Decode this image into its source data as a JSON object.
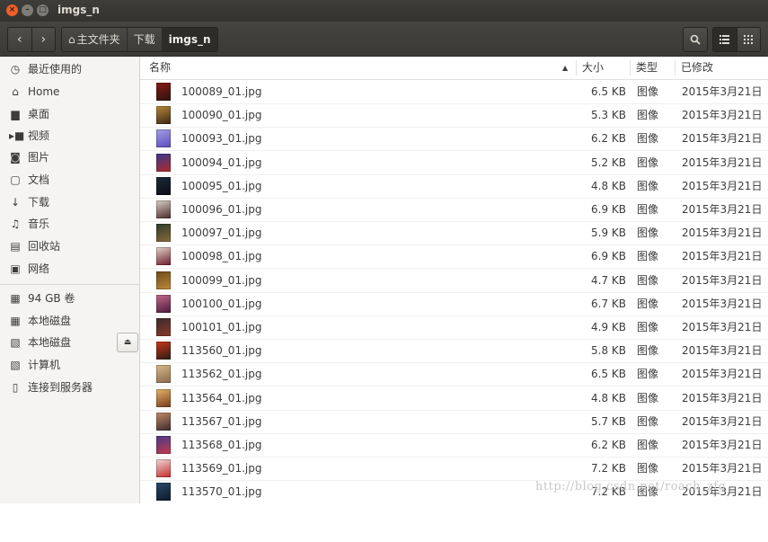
{
  "window": {
    "title": "imgs_n",
    "close_glyph": "×",
    "min_glyph": "–",
    "max_glyph": "□"
  },
  "toolbar": {
    "back_glyph": "‹",
    "forward_glyph": "›",
    "breadcrumbs": [
      "主文件夹",
      "下载",
      "imgs_n"
    ],
    "home_glyph": "⌂",
    "search_glyph": "🔍",
    "list_view_glyph": "☰",
    "grid_view_glyph": "⋮⋮"
  },
  "sidebar": {
    "items": [
      {
        "label": "最近使用的",
        "icon": "clock-icon",
        "glyph": "◷"
      },
      {
        "label": "Home",
        "icon": "home-icon",
        "glyph": "⌂"
      },
      {
        "label": "桌面",
        "icon": "desktop-icon",
        "glyph": "▆"
      },
      {
        "label": "视频",
        "icon": "video-icon",
        "glyph": "▸■"
      },
      {
        "label": "图片",
        "icon": "camera-icon",
        "glyph": "◙"
      },
      {
        "label": "文档",
        "icon": "document-icon",
        "glyph": "▢"
      },
      {
        "label": "下载",
        "icon": "download-icon",
        "glyph": "↓"
      },
      {
        "label": "音乐",
        "icon": "music-icon",
        "glyph": "♫"
      },
      {
        "label": "回收站",
        "icon": "trash-icon",
        "glyph": "▤"
      },
      {
        "label": "网络",
        "icon": "network-icon",
        "glyph": "▣"
      }
    ],
    "devices": [
      {
        "label": "94 GB 卷",
        "icon": "drive-icon",
        "glyph": "▦"
      },
      {
        "label": "本地磁盘",
        "icon": "drive-icon",
        "glyph": "▦"
      },
      {
        "label": "本地磁盘",
        "icon": "drive-icon",
        "glyph": "▧",
        "eject": "⏏"
      },
      {
        "label": "计算机",
        "icon": "computer-icon",
        "glyph": "▧"
      },
      {
        "label": "连接到服务器",
        "icon": "server-icon",
        "glyph": "▯"
      }
    ]
  },
  "columns": {
    "name": "名称",
    "size": "大小",
    "type": "类型",
    "modified": "已修改",
    "sort_glyph": "▲"
  },
  "files": [
    {
      "name": "100089_01.jpg",
      "size": "6.5 KB",
      "type": "图像",
      "modified": "2015年3月21日",
      "thumb_colors": [
        "#8a1a14",
        "#2a1410"
      ]
    },
    {
      "name": "100090_01.jpg",
      "size": "5.3 KB",
      "type": "图像",
      "modified": "2015年3月21日",
      "thumb_colors": [
        "#b98a3a",
        "#3a2614"
      ]
    },
    {
      "name": "100093_01.jpg",
      "size": "6.2 KB",
      "type": "图像",
      "modified": "2015年3月21日",
      "thumb_colors": [
        "#a4a0e4",
        "#5a4cc0"
      ]
    },
    {
      "name": "100094_01.jpg",
      "size": "5.2 KB",
      "type": "图像",
      "modified": "2015年3月21日",
      "thumb_colors": [
        "#3a3a8a",
        "#b02a2a"
      ]
    },
    {
      "name": "100095_01.jpg",
      "size": "4.8 KB",
      "type": "图像",
      "modified": "2015年3月21日",
      "thumb_colors": [
        "#1c2a3a",
        "#0c0c14"
      ]
    },
    {
      "name": "100096_01.jpg",
      "size": "6.9 KB",
      "type": "图像",
      "modified": "2015年3月21日",
      "thumb_colors": [
        "#d8d0c8",
        "#4a2a2a"
      ]
    },
    {
      "name": "100097_01.jpg",
      "size": "5.9 KB",
      "type": "图像",
      "modified": "2015年3月21日",
      "thumb_colors": [
        "#2a3a2a",
        "#8a6a3a"
      ]
    },
    {
      "name": "100098_01.jpg",
      "size": "6.9 KB",
      "type": "图像",
      "modified": "2015年3月21日",
      "thumb_colors": [
        "#e4d4c8",
        "#6a1a2a"
      ]
    },
    {
      "name": "100099_01.jpg",
      "size": "4.7 KB",
      "type": "图像",
      "modified": "2015年3月21日",
      "thumb_colors": [
        "#6a4a1a",
        "#c08a3a"
      ]
    },
    {
      "name": "100100_01.jpg",
      "size": "6.7 KB",
      "type": "图像",
      "modified": "2015年3月21日",
      "thumb_colors": [
        "#c46a8a",
        "#4a1a3a"
      ]
    },
    {
      "name": "100101_01.jpg",
      "size": "4.9 KB",
      "type": "图像",
      "modified": "2015年3月21日",
      "thumb_colors": [
        "#3a2a2a",
        "#8a3a2a"
      ]
    },
    {
      "name": "113560_01.jpg",
      "size": "5.8 KB",
      "type": "图像",
      "modified": "2015年3月21日",
      "thumb_colors": [
        "#c83a1a",
        "#2a1a14"
      ]
    },
    {
      "name": "113562_01.jpg",
      "size": "6.5 KB",
      "type": "图像",
      "modified": "2015年3月21日",
      "thumb_colors": [
        "#d8b88a",
        "#8a6a4a"
      ]
    },
    {
      "name": "113564_01.jpg",
      "size": "4.8 KB",
      "type": "图像",
      "modified": "2015年3月21日",
      "thumb_colors": [
        "#e4b46a",
        "#7a3a1a"
      ]
    },
    {
      "name": "113567_01.jpg",
      "size": "5.7 KB",
      "type": "图像",
      "modified": "2015年3月21日",
      "thumb_colors": [
        "#c48a6a",
        "#3a2a2a"
      ]
    },
    {
      "name": "113568_01.jpg",
      "size": "6.2 KB",
      "type": "图像",
      "modified": "2015年3月21日",
      "thumb_colors": [
        "#4a3a8a",
        "#c43a4a"
      ]
    },
    {
      "name": "113569_01.jpg",
      "size": "7.2 KB",
      "type": "图像",
      "modified": "2015年3月21日",
      "thumb_colors": [
        "#f0d8d8",
        "#c42a2a"
      ]
    },
    {
      "name": "113570_01.jpg",
      "size": "7.2 KB",
      "type": "图像",
      "modified": "2015年3月21日",
      "thumb_colors": [
        "#2a4a6a",
        "#0c1a2a"
      ]
    }
  ],
  "watermark": "http://blog.csdn.net/roach_zfg"
}
